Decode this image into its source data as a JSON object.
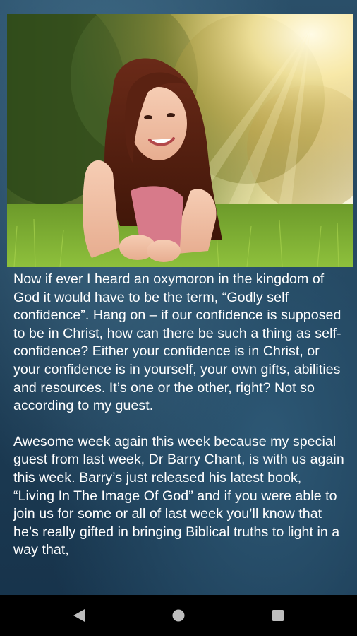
{
  "hero": {
    "image_alt": "Smiling young woman lying on green grass with sunlight streaming through trees"
  },
  "article": {
    "paragraphs": [
      " Now if ever I heard an oxymoron in the kingdom of God it would have to be the term, “Godly self confidence”. Hang on – if our confidence is supposed to be in Christ, how can there be such a thing as self-confidence? Either your confidence is in Christ, or your confidence is in yourself, your own gifts, abilities and resources. It’s one or the other, right? Not so according to my guest.",
      "Awesome week again this week because my special guest from last week, Dr Barry Chant, is with us again this week. Barry’s just released his latest book, “Living In The Image Of God” and if you were able to join us for some or all of last week you’ll know that he’s really gifted in bringing Biblical truths to light in a way that,"
    ]
  },
  "navbar": {
    "back_icon": "back-triangle-icon",
    "home_icon": "home-circle-icon",
    "recent_icon": "recent-square-icon",
    "icon_color": "#bdbdbd"
  }
}
